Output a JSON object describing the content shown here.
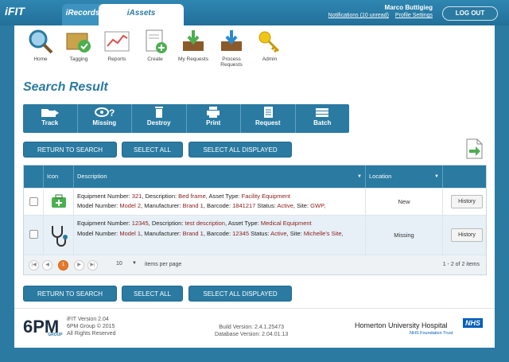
{
  "app": {
    "logo": "iFIT",
    "tabs": [
      "iRecords",
      "iAssets"
    ]
  },
  "user": {
    "name": "Marco Buttigieg",
    "notifications": "Notifications (10 unread)",
    "profile": "Profile Settings",
    "logout": "LOG OUT"
  },
  "nav": [
    "Home",
    "Tagging",
    "Reports",
    "Create",
    "My Requests",
    "Process Requests",
    "Admin"
  ],
  "page_title": "Search Result",
  "actions": [
    "Track",
    "Missing",
    "Destroy",
    "Print",
    "Request",
    "Batch"
  ],
  "buttons": {
    "return": "RETURN TO SEARCH",
    "select_all": "SELECT ALL",
    "select_displayed": "SELECT ALL DISPLAYED"
  },
  "grid": {
    "headers": {
      "icon": "Icon",
      "description": "Description",
      "location": "Location"
    },
    "rows": [
      {
        "l1_labels": [
          "Equipment Number: ",
          ", Description: ",
          ", Asset Type: "
        ],
        "l1_values": [
          "321",
          "Bed frame",
          "Facility Equipment"
        ],
        "l2_labels": [
          "Model Number: ",
          ", Manufacturer: ",
          ", Barcode: ",
          " Status: ",
          ", Site: "
        ],
        "l2_values": [
          "Model 2",
          "Brand 1",
          "1841217",
          "Active",
          "GWP,"
        ],
        "location": "New",
        "history": "History"
      },
      {
        "l1_labels": [
          "Equipment Number: ",
          ", Description: ",
          ", Asset Type: "
        ],
        "l1_values": [
          "12345",
          "test description",
          "Medical Equipment"
        ],
        "l2_labels": [
          "Model Number: ",
          ", Manufacturer: ",
          ", Barcode: ",
          " Status: ",
          ", Site: "
        ],
        "l2_values": [
          "Model 1",
          "Brand 1",
          "12345",
          "Active",
          "Michelle's Site,"
        ],
        "location": "Missing",
        "history": "History"
      }
    ],
    "pager": {
      "current": "1",
      "page_size": "10",
      "per_page_label": "items per page",
      "summary": "1 - 2 of 2 items"
    }
  },
  "footer": {
    "brand": "6PM",
    "brand_sub": "GROUP",
    "version": "iFIT Version 2.04",
    "copyright": "6PM Group © 2015",
    "rights": "All Rights Reserved",
    "build": "Build Version: 2.4.1.25473",
    "db": "Database Version: 2.04.01.13",
    "hospital": "Homerton University Hospital",
    "nhs": "NHS",
    "trust": "NHS Foundation Trust"
  }
}
